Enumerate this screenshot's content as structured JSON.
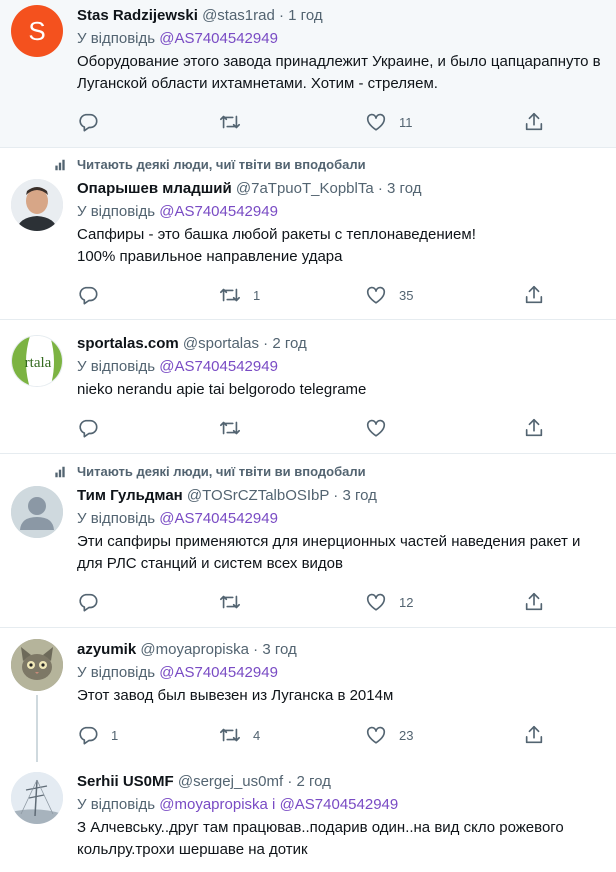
{
  "colors": {
    "link": "#794bc4",
    "muted": "#536471",
    "text": "#0f1419"
  },
  "tweets": [
    {
      "name": "Stas Radzijewski",
      "handle": "@stas1rad",
      "dot": "·",
      "time": "1 год",
      "reply_prefix": "У відповідь",
      "reply_to": "@AS7404542949",
      "text": "Оборудование этого завода принадлежит Украине,  и было цапцарапнуто в Луганской области ихтамнетами. Хотим - стреляем.",
      "avatar_letter": "S",
      "stats": {
        "replies": "",
        "retweets": "",
        "likes": "11"
      }
    },
    {
      "social": "Читають деякі люди, чиї твіти ви вподобали",
      "name": "Опарышев младший",
      "handle": "@7aTpuoT_KopblTa",
      "dot": "·",
      "time": "3 год",
      "reply_prefix": "У відповідь",
      "reply_to": "@AS7404542949",
      "text": "Сапфиры - это башка любой ракеты с теплонаведением!\n100% правильное направление удара",
      "stats": {
        "replies": "",
        "retweets": "1",
        "likes": "35"
      }
    },
    {
      "name": "sportalas.com",
      "handle": "@sportalas",
      "dot": "·",
      "time": "2 год",
      "reply_prefix": "У відповідь",
      "reply_to": "@AS7404542949",
      "text": "nieko nerandu apie tai belgorodo telegrame",
      "avatar_text": "rtala",
      "stats": {
        "replies": "",
        "retweets": "",
        "likes": ""
      }
    },
    {
      "social": "Читають деякі люди, чиї твіти ви вподобали",
      "name": "Тим Гульдман",
      "handle": "@TOSrCZTalbOSIbP",
      "dot": "·",
      "time": "3 год",
      "reply_prefix": "У відповідь",
      "reply_to": "@AS7404542949",
      "text": "Эти сапфиры применяются для инерционных частей наведения ракет и для РЛС станций и систем всех видов",
      "stats": {
        "replies": "",
        "retweets": "",
        "likes": "12"
      }
    },
    {
      "name": "azyumik",
      "handle": "@moyapropiska",
      "dot": "·",
      "time": "3 год",
      "reply_prefix": "У відповідь",
      "reply_to": "@AS7404542949",
      "text": "Этот завод был вывезен из Луганска в 2014м",
      "stats": {
        "replies": "1",
        "retweets": "4",
        "likes": "23"
      }
    },
    {
      "name": "Serhii US0MF",
      "handle": "@sergej_us0mf",
      "dot": "·",
      "time": "2 год",
      "reply_prefix": "У відповідь",
      "reply_to": "@moyapropiska",
      "reply_joiner": "і",
      "reply_to2": "@AS7404542949",
      "text": "З Алчевську..друг там працював..подарив один..на вид скло рожевого кольлру.трохи шершаве на дотик"
    }
  ]
}
